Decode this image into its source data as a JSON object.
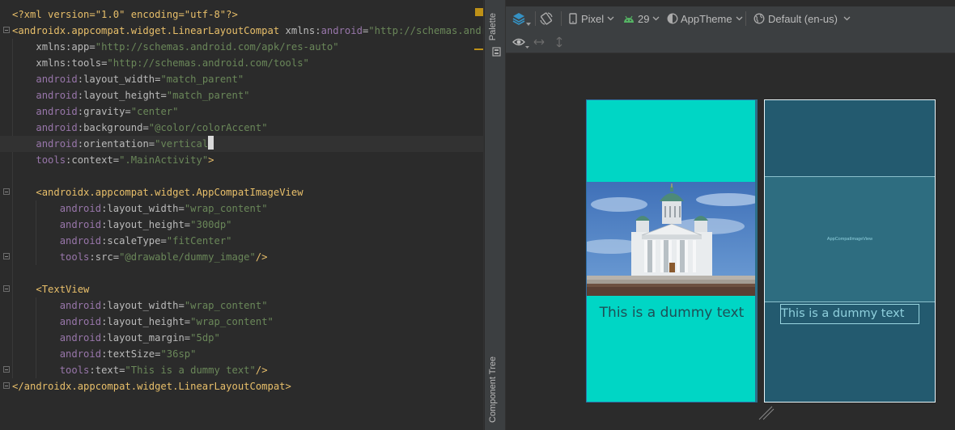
{
  "editor": {
    "lines": [
      {
        "parts": [
          [
            "pi",
            "<?xml version=\"1.0\" encoding=\"utf-8\"?>"
          ]
        ]
      },
      {
        "parts": [
          [
            "t",
            "<androidx.appcompat.widget.LinearLayoutCompat "
          ],
          [
            "at",
            "xmlns:"
          ],
          [
            "ns",
            "android"
          ],
          [
            "at",
            "="
          ],
          [
            "v",
            "\"http://schemas.android"
          ]
        ]
      },
      {
        "parts": [
          [
            "sp",
            "    "
          ],
          [
            "at",
            "xmlns:app="
          ],
          [
            "v",
            "\"http://schemas.android.com/apk/res-auto\""
          ]
        ]
      },
      {
        "parts": [
          [
            "sp",
            "    "
          ],
          [
            "at",
            "xmlns:tools="
          ],
          [
            "v",
            "\"http://schemas.android.com/tools\""
          ]
        ]
      },
      {
        "parts": [
          [
            "sp",
            "    "
          ],
          [
            "ns",
            "android"
          ],
          [
            "at",
            ":layout_width="
          ],
          [
            "v",
            "\"match_parent\""
          ]
        ]
      },
      {
        "parts": [
          [
            "sp",
            "    "
          ],
          [
            "ns",
            "android"
          ],
          [
            "at",
            ":layout_height="
          ],
          [
            "v",
            "\"match_parent\""
          ]
        ]
      },
      {
        "parts": [
          [
            "sp",
            "    "
          ],
          [
            "ns",
            "android"
          ],
          [
            "at",
            ":gravity="
          ],
          [
            "v",
            "\"center\""
          ]
        ]
      },
      {
        "parts": [
          [
            "sp",
            "    "
          ],
          [
            "ns",
            "android"
          ],
          [
            "at",
            ":background="
          ],
          [
            "v",
            "\"@color/colorAccent\""
          ]
        ]
      },
      {
        "parts": [
          [
            "sp",
            "    "
          ],
          [
            "ns",
            "android"
          ],
          [
            "at",
            ":orientation="
          ],
          [
            "v",
            "\"vertical\""
          ]
        ],
        "current": true,
        "caret": true
      },
      {
        "parts": [
          [
            "sp",
            "    "
          ],
          [
            "ns",
            "tools"
          ],
          [
            "at",
            ":context="
          ],
          [
            "v",
            "\".MainActivity\""
          ],
          [
            "t",
            ">"
          ]
        ]
      },
      {
        "parts": []
      },
      {
        "parts": [
          [
            "sp",
            "    "
          ],
          [
            "t",
            "<androidx.appcompat.widget.AppCompatImageView"
          ]
        ]
      },
      {
        "parts": [
          [
            "sp",
            "        "
          ],
          [
            "ns",
            "android"
          ],
          [
            "at",
            ":layout_width="
          ],
          [
            "v",
            "\"wrap_content\""
          ]
        ]
      },
      {
        "parts": [
          [
            "sp",
            "        "
          ],
          [
            "ns",
            "android"
          ],
          [
            "at",
            ":layout_height="
          ],
          [
            "v",
            "\"300dp\""
          ]
        ]
      },
      {
        "parts": [
          [
            "sp",
            "        "
          ],
          [
            "ns",
            "android"
          ],
          [
            "at",
            ":scaleType="
          ],
          [
            "v",
            "\"fitCenter\""
          ]
        ]
      },
      {
        "parts": [
          [
            "sp",
            "        "
          ],
          [
            "ns",
            "tools"
          ],
          [
            "at",
            ":src="
          ],
          [
            "v",
            "\"@drawable/dummy_image\""
          ],
          [
            "t",
            "/>"
          ]
        ]
      },
      {
        "parts": []
      },
      {
        "parts": [
          [
            "sp",
            "    "
          ],
          [
            "t",
            "<TextView"
          ]
        ]
      },
      {
        "parts": [
          [
            "sp",
            "        "
          ],
          [
            "ns",
            "android"
          ],
          [
            "at",
            ":layout_width="
          ],
          [
            "v",
            "\"wrap_content\""
          ]
        ]
      },
      {
        "parts": [
          [
            "sp",
            "        "
          ],
          [
            "ns",
            "android"
          ],
          [
            "at",
            ":layout_height="
          ],
          [
            "v",
            "\"wrap_content\""
          ]
        ]
      },
      {
        "parts": [
          [
            "sp",
            "        "
          ],
          [
            "ns",
            "android"
          ],
          [
            "at",
            ":layout_margin="
          ],
          [
            "v",
            "\"5dp\""
          ]
        ]
      },
      {
        "parts": [
          [
            "sp",
            "        "
          ],
          [
            "ns",
            "android"
          ],
          [
            "at",
            ":textSize="
          ],
          [
            "v",
            "\"36sp\""
          ]
        ]
      },
      {
        "parts": [
          [
            "sp",
            "        "
          ],
          [
            "ns",
            "tools"
          ],
          [
            "at",
            ":text="
          ],
          [
            "v",
            "\"This is a dummy text\""
          ],
          [
            "t",
            "/>"
          ]
        ]
      },
      {
        "parts": [
          [
            "t",
            "</androidx.appcompat.widget.LinearLayoutCompat>"
          ]
        ]
      }
    ],
    "colors": {
      "tag": "#e8bf6a",
      "namespace": "#9876aa",
      "attribute": "#bababa",
      "value": "#6a8759"
    }
  },
  "side_tabs": {
    "palette": "Palette",
    "component_tree": "Component Tree"
  },
  "toolbar": {
    "device": "Pixel",
    "api_level": "29",
    "theme": "AppTheme",
    "locale": "Default (en-us)",
    "icons": [
      "layers-icon",
      "rotate-icon",
      "phone-icon",
      "android-icon",
      "theme-icon",
      "globe-icon",
      "eye-icon",
      "horizontal-resize-icon",
      "vertical-resize-icon"
    ]
  },
  "preview": {
    "text": "This is a dummy text",
    "background_color": "#00d6c5",
    "text_color": "#1e4f56"
  },
  "blueprint": {
    "image_label": "AppCompatImageView",
    "text": "This is a dummy text",
    "background_color": "#235a6f"
  }
}
